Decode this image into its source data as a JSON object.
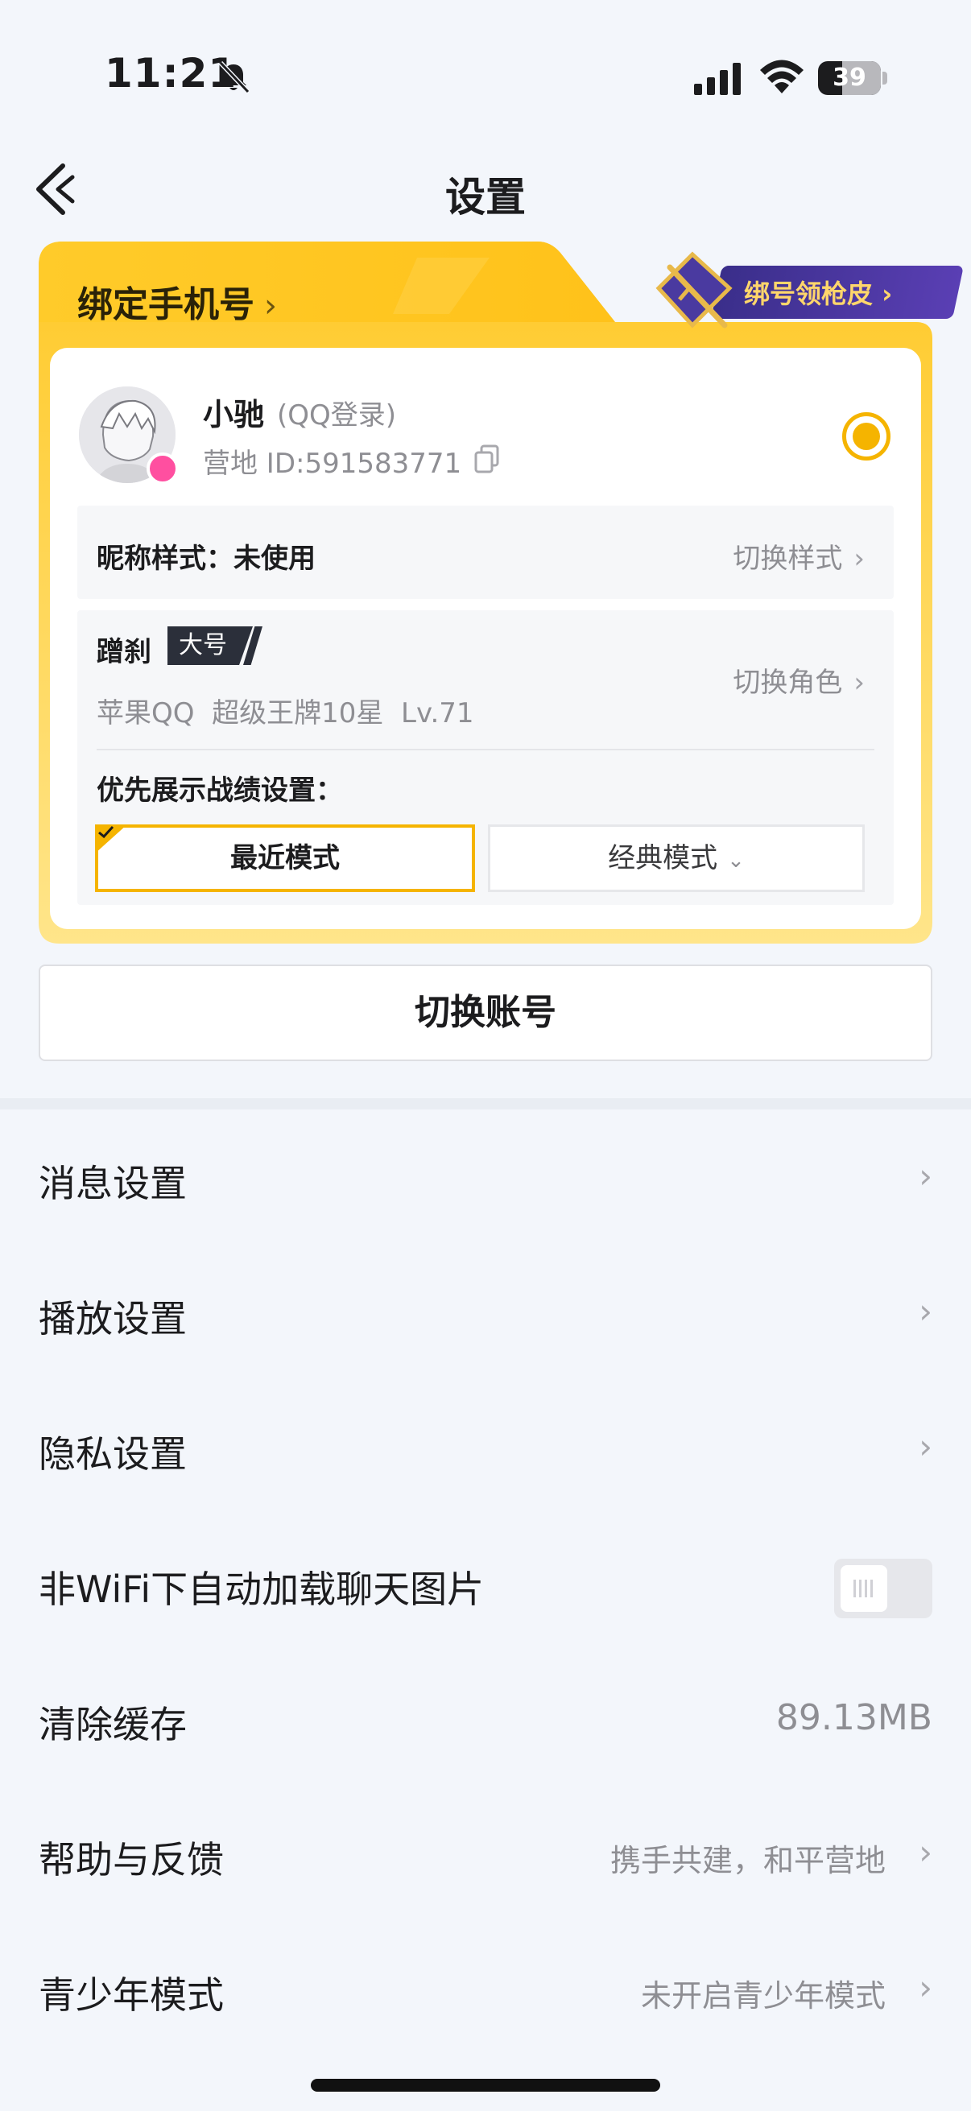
{
  "status_bar": {
    "time": "11:21",
    "battery_level": 39,
    "battery_label": "39",
    "icons": [
      "bell-slash-icon",
      "cellular-signal-icon",
      "wifi-icon",
      "battery-icon"
    ]
  },
  "nav": {
    "title": "设置",
    "back_icon": "back-arrow-icon"
  },
  "account_card": {
    "bind_phone_label": "绑定手机号",
    "bind_phone_chevron": "›",
    "promo_label": "绑号领枪皮 ›",
    "user": {
      "name": "小驰",
      "login_type": "(QQ登录)",
      "camp_id": "营地 ID:591583771"
    },
    "nickname_style": {
      "label": "昵称样式：未使用",
      "action": "切换样式",
      "chevron": "›"
    },
    "role": {
      "name": "蹭刹",
      "tag": "大号",
      "detail": "苹果QQ  超级王牌10星  Lv.71",
      "action": "切换角色",
      "chevron": "›"
    },
    "priority": {
      "label": "优先展示战绩设置：",
      "recent_mode": "最近模式",
      "classic_mode": "经典模式",
      "classic_chevron": "⌄",
      "selected": "recent"
    },
    "accent_color": "#f5b400"
  },
  "switch_account_label": "切换账号",
  "settings": [
    {
      "label": "消息设置",
      "chevron": "›"
    },
    {
      "label": "播放设置",
      "chevron": "›"
    },
    {
      "label": "隐私设置",
      "chevron": "›"
    },
    {
      "label": "非WiFi下自动加载聊天图片",
      "toggle_on": false
    },
    {
      "label": "清除缓存",
      "value": "89.13MB"
    },
    {
      "label": "帮助与反馈",
      "value": "携手共建，和平营地",
      "chevron": "›"
    },
    {
      "label": "青少年模式",
      "value": "未开启青少年模式",
      "chevron": "›"
    }
  ]
}
